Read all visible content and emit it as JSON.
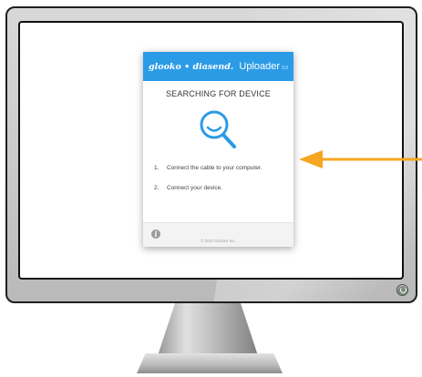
{
  "app": {
    "brand": "glooko • diasend.",
    "title": "Uploader",
    "title_suffix": "3.0",
    "status": "SEARCHING FOR DEVICE",
    "steps": [
      {
        "num": "1.",
        "text": "Connect the cable to your computer."
      },
      {
        "num": "2.",
        "text": "Connect your device."
      }
    ],
    "info_icon_glyph": "i",
    "copyright": "© 2017 Glooko Inc."
  },
  "colors": {
    "header_blue": "#2b9be6",
    "magnifier_blue": "#2b9be6",
    "arrow_orange": "#f5a623"
  },
  "icons": {
    "magnifier": "search-icon",
    "info": "info-icon",
    "power": "power-icon",
    "arrow": "arrow-left-icon"
  }
}
